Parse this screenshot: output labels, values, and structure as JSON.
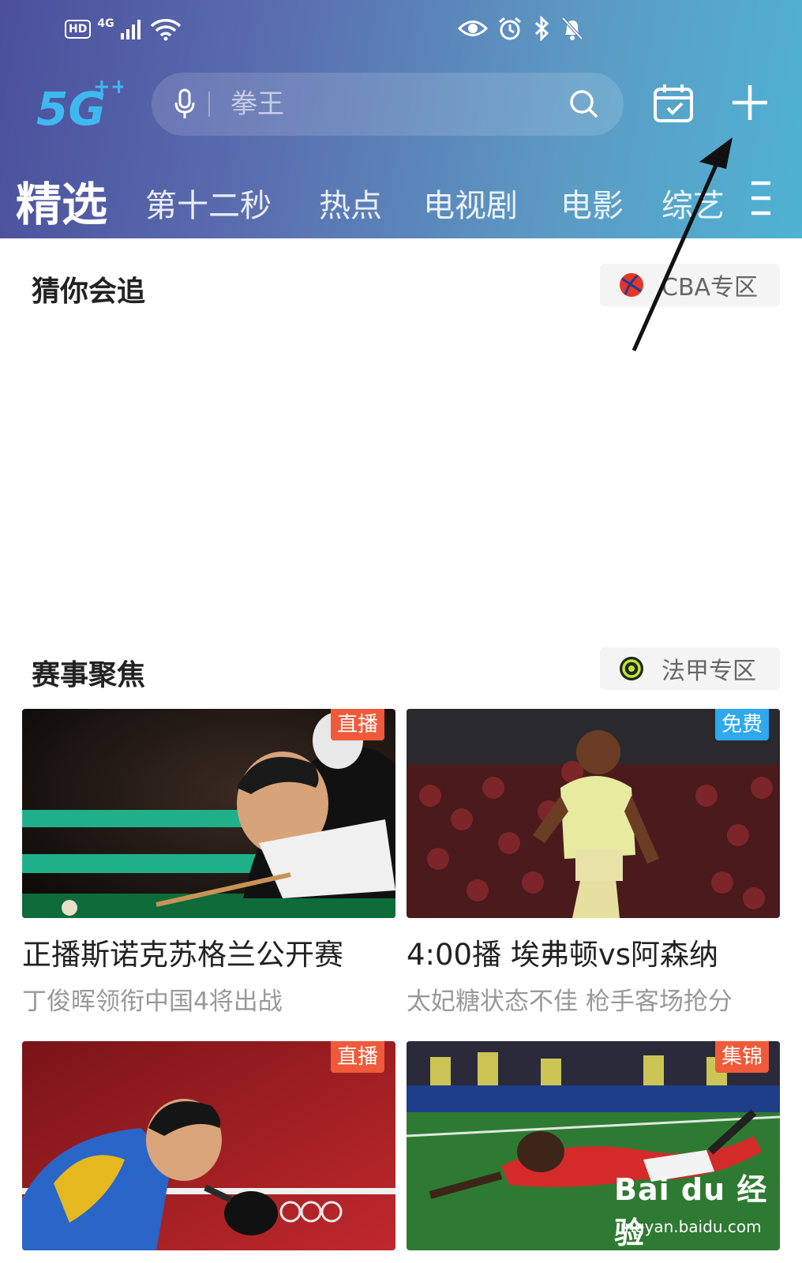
{
  "status_bar": {
    "hd": "HD",
    "network": "4G"
  },
  "search": {
    "placeholder": "拳王"
  },
  "tabs": [
    {
      "label": "精选"
    },
    {
      "label": "第十二秒"
    },
    {
      "label": "热点"
    },
    {
      "label": "电视剧"
    },
    {
      "label": "电影"
    },
    {
      "label": "综艺"
    }
  ],
  "sections": {
    "guess": {
      "title": "猜你会追",
      "zone_label": "CBA专区"
    },
    "events": {
      "title": "赛事聚焦",
      "zone_label": "法甲专区"
    }
  },
  "cards": [
    {
      "badge": "直播",
      "title": "正播斯诺克苏格兰公开赛",
      "subtitle": "丁俊晖领衔中国4将出战"
    },
    {
      "badge": "免费",
      "title": "4:00播 埃弗顿vs阿森纳",
      "subtitle": "太妃糖状态不佳 枪手客场抢分"
    },
    {
      "badge": "直播"
    },
    {
      "badge": "集锦"
    }
  ],
  "watermark": {
    "title": "Bai du 经验",
    "url": "jingyan.baidu.com"
  },
  "colors": {
    "live_badge": "#ef5a3a",
    "free_badge": "#2ea8ee",
    "header_start": "#4b4f9c",
    "header_end": "#4fb3d3"
  }
}
